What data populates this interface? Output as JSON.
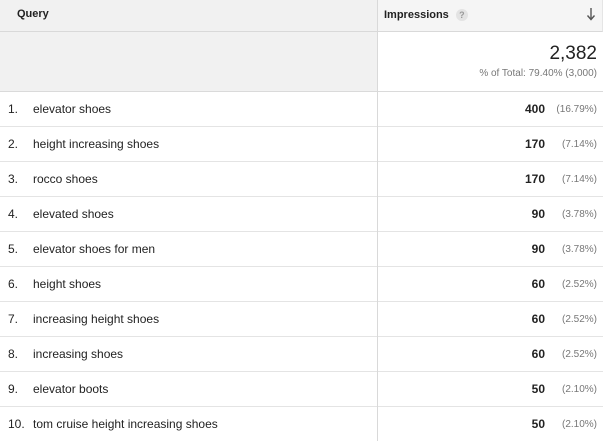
{
  "header": {
    "query_label": "Query",
    "impressions_label": "Impressions",
    "help_icon": "?",
    "sort_icon": "arrow-down-icon"
  },
  "summary": {
    "total": "2,382",
    "pct_of_total": "% of Total: 79.40% (3,000)"
  },
  "rows": [
    {
      "num": "1.",
      "query": "elevator shoes",
      "value": "400",
      "pct": "(16.79%)"
    },
    {
      "num": "2.",
      "query": "height increasing shoes",
      "value": "170",
      "pct": "(7.14%)"
    },
    {
      "num": "3.",
      "query": "rocco shoes",
      "value": "170",
      "pct": "(7.14%)"
    },
    {
      "num": "4.",
      "query": "elevated shoes",
      "value": "90",
      "pct": "(3.78%)"
    },
    {
      "num": "5.",
      "query": "elevator shoes for men",
      "value": "90",
      "pct": "(3.78%)"
    },
    {
      "num": "6.",
      "query": "height shoes",
      "value": "60",
      "pct": "(2.52%)"
    },
    {
      "num": "7.",
      "query": "increasing height shoes",
      "value": "60",
      "pct": "(2.52%)"
    },
    {
      "num": "8.",
      "query": "increasing shoes",
      "value": "60",
      "pct": "(2.52%)"
    },
    {
      "num": "9.",
      "query": "elevator boots",
      "value": "50",
      "pct": "(2.10%)"
    },
    {
      "num": "10.",
      "query": "tom cruise height increasing shoes",
      "value": "50",
      "pct": "(2.10%)"
    }
  ]
}
